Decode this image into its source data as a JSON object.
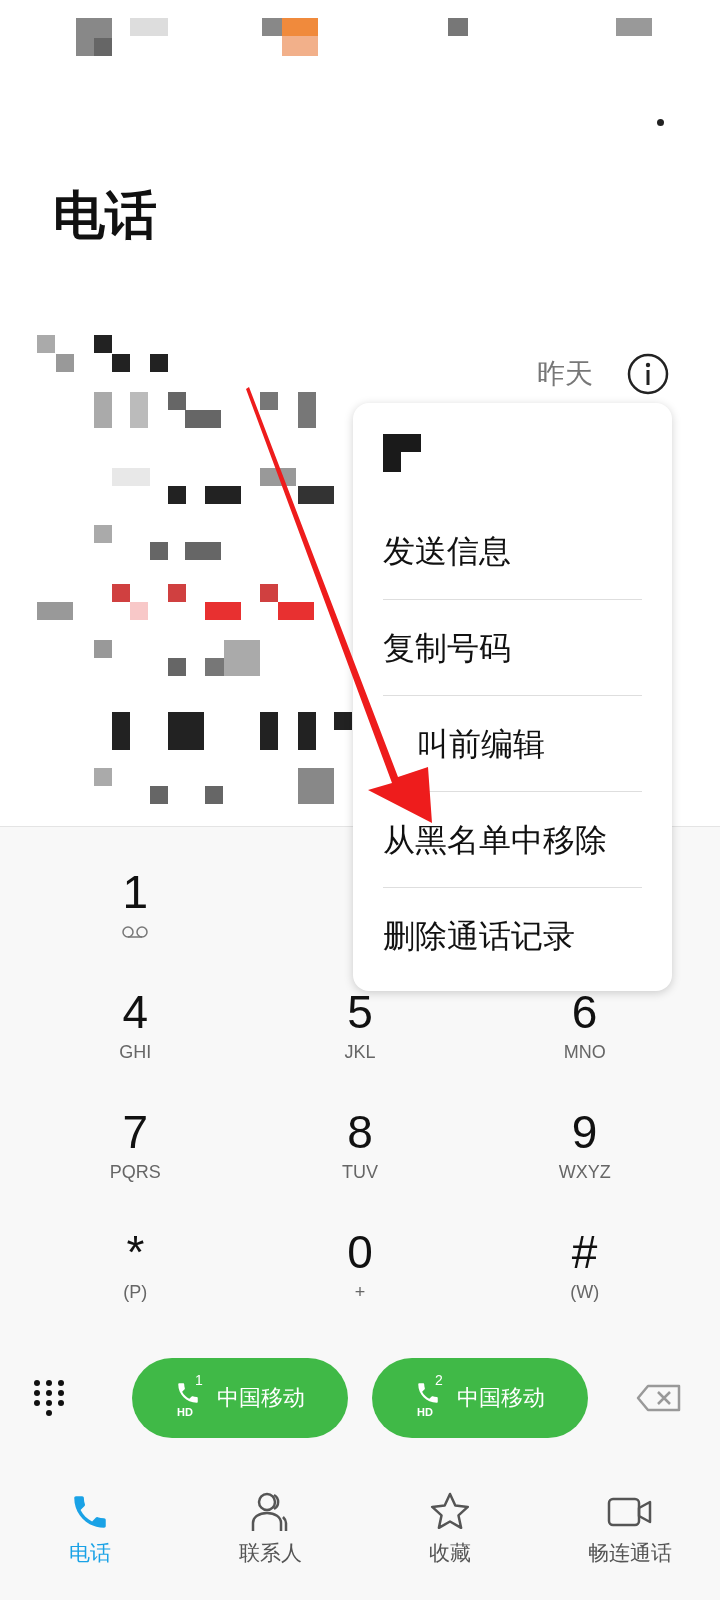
{
  "title": "电话",
  "call_log": {
    "time": "昨天"
  },
  "menu": {
    "items": [
      {
        "kind": "plain",
        "label": "发送信息"
      },
      {
        "kind": "plain",
        "label": "复制号码"
      },
      {
        "kind": "covered",
        "label": "叫前编辑"
      },
      {
        "kind": "plain",
        "label": "从黑名单中移除"
      },
      {
        "kind": "plain",
        "label": "删除通话记录"
      }
    ]
  },
  "keypad": [
    {
      "kind": "voicemail",
      "digit": "1"
    },
    {
      "kind": "hidden"
    },
    {
      "kind": "hidden"
    },
    {
      "kind": "letters",
      "digit": "4",
      "letters": "GHI"
    },
    {
      "kind": "letters",
      "digit": "5",
      "letters": "JKL"
    },
    {
      "kind": "letters",
      "digit": "6",
      "letters": "MNO"
    },
    {
      "kind": "letters",
      "digit": "7",
      "letters": "PQRS"
    },
    {
      "kind": "letters",
      "digit": "8",
      "letters": "TUV"
    },
    {
      "kind": "letters",
      "digit": "9",
      "letters": "WXYZ"
    },
    {
      "kind": "letters",
      "digit": "*",
      "letters": "(P)"
    },
    {
      "kind": "letters",
      "digit": "0",
      "letters": "+"
    },
    {
      "kind": "letters",
      "digit": "#",
      "letters": "(W)"
    }
  ],
  "call_buttons": [
    {
      "sim": "1",
      "badge": "HD",
      "carrier": "中国移动"
    },
    {
      "sim": "2",
      "badge": "HD",
      "carrier": "中国移动"
    }
  ],
  "nav": [
    {
      "label": "电话",
      "selected": true
    },
    {
      "label": "联系人",
      "selected": false
    },
    {
      "label": "收藏",
      "selected": false
    },
    {
      "label": "畅连通话",
      "selected": false
    }
  ]
}
